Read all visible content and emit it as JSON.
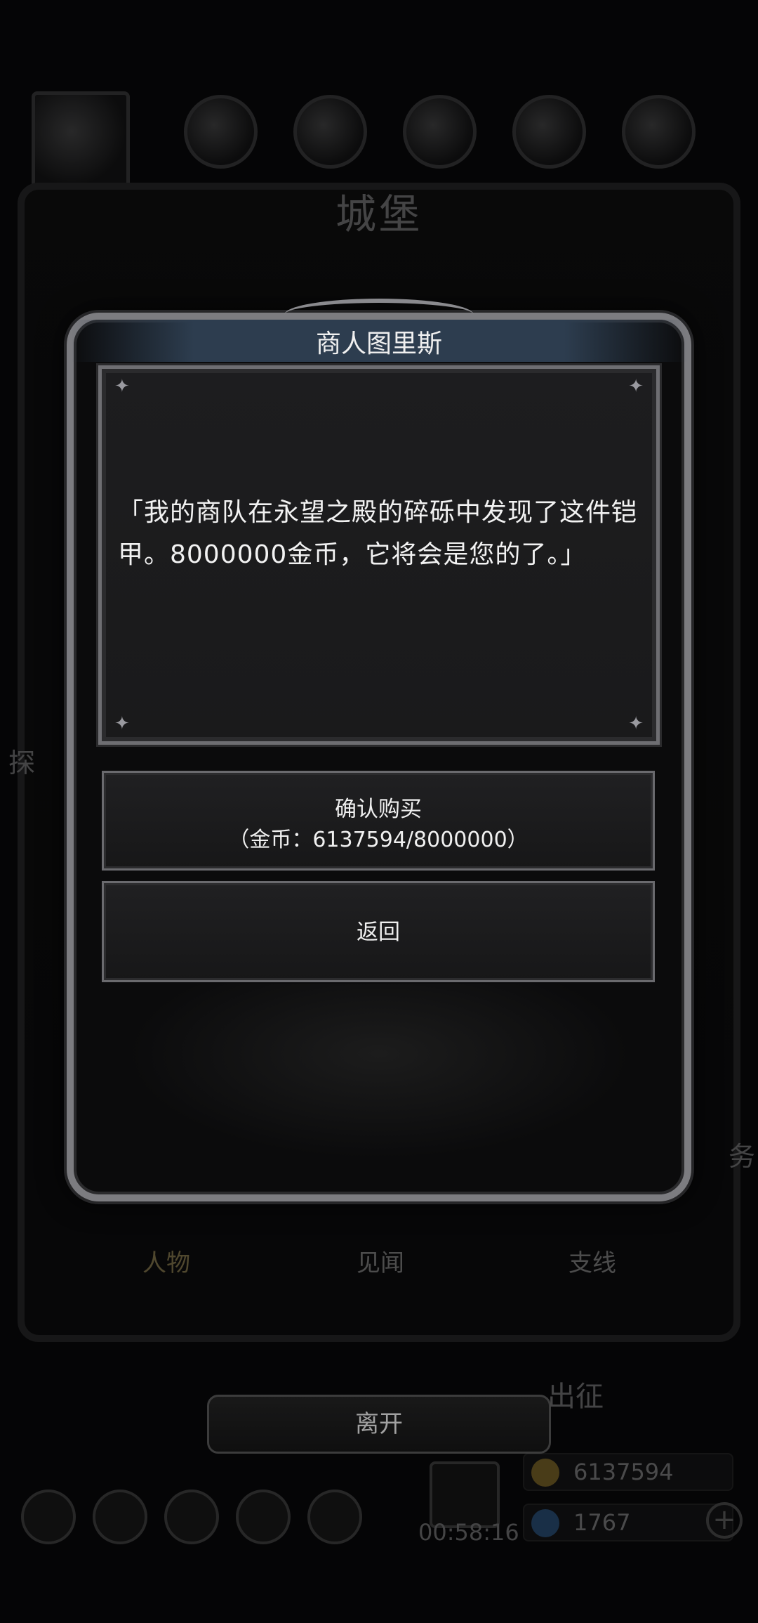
{
  "background": {
    "castle_title": "城堡",
    "tabs": [
      {
        "label": "人物"
      },
      {
        "label": "见闻"
      },
      {
        "label": "支线"
      }
    ],
    "side_label_left": "探",
    "side_label_right": "务",
    "expedition_label": "出征",
    "leave_label": "离开",
    "gold_amount": "6137594",
    "gem_amount": "1767",
    "timer": "00:58:16"
  },
  "dialog": {
    "title": "商人图里斯",
    "message": "「我的商队在永望之殿的碎砾中发现了这件铠甲。8000000金币，它将会是您的了。」",
    "confirm_label": "确认购买",
    "confirm_cost": "（金币：6137594/8000000）",
    "back_label": "返回"
  },
  "colors": {
    "frame": "#7c7c80",
    "panel": "#1c1c1e",
    "header": "#2d3d4f",
    "gold_icon": "#c9a23a",
    "gem_icon": "#3e7fc0"
  }
}
